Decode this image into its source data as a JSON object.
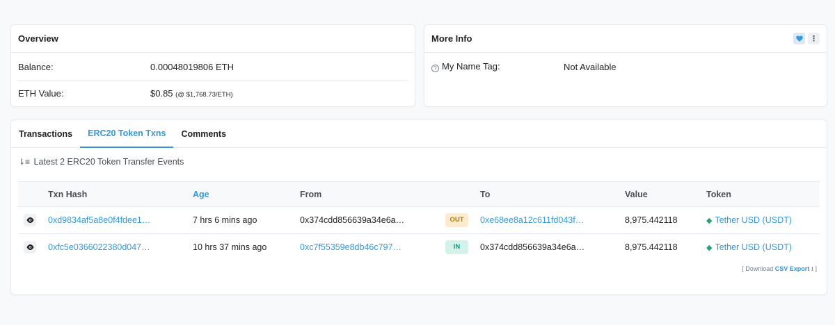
{
  "overview": {
    "title": "Overview",
    "balance_label": "Balance:",
    "balance_value": "0.00048019806 ETH",
    "eth_value_label": "ETH Value:",
    "eth_value": "$0.85",
    "eth_rate": "(@ $1,768.73/ETH)"
  },
  "more_info": {
    "title": "More Info",
    "name_tag_label": "My Name Tag:",
    "name_tag_value": "Not Available"
  },
  "tabs": [
    {
      "label": "Transactions",
      "active": false
    },
    {
      "label": "ERC20 Token Txns",
      "active": true
    },
    {
      "label": "Comments",
      "active": false
    }
  ],
  "summary": "Latest 2 ERC20 Token Transfer Events",
  "table": {
    "headers": [
      "Txn Hash",
      "Age",
      "From",
      "To",
      "Value",
      "Token"
    ],
    "rows": [
      {
        "hash": "0xd9834af5a8e0f4fdee1…",
        "age": "7 hrs 6 mins ago",
        "from": "0x374cdd856639a34e6a…",
        "direction": "OUT",
        "to": "0xe68ee8a12c611fd043f…",
        "value": "8,975.442118",
        "token": "Tether USD (USDT)"
      },
      {
        "hash": "0xfc5e0366022380d047…",
        "age": "10 hrs 37 mins ago",
        "from": "0xc7f55359e8db46c797…",
        "direction": "IN",
        "to": "0x374cdd856639a34e6a…",
        "value": "8,975.442118",
        "token": "Tether USD (USDT)"
      }
    ]
  },
  "csv": {
    "open": "[ Download",
    "link": "CSV Export",
    "close": "]"
  },
  "colors": {
    "accent": "#3498db",
    "out_badge": "#fcebce",
    "in_badge": "#d4f1ea",
    "token_icon": "#26a17b"
  }
}
